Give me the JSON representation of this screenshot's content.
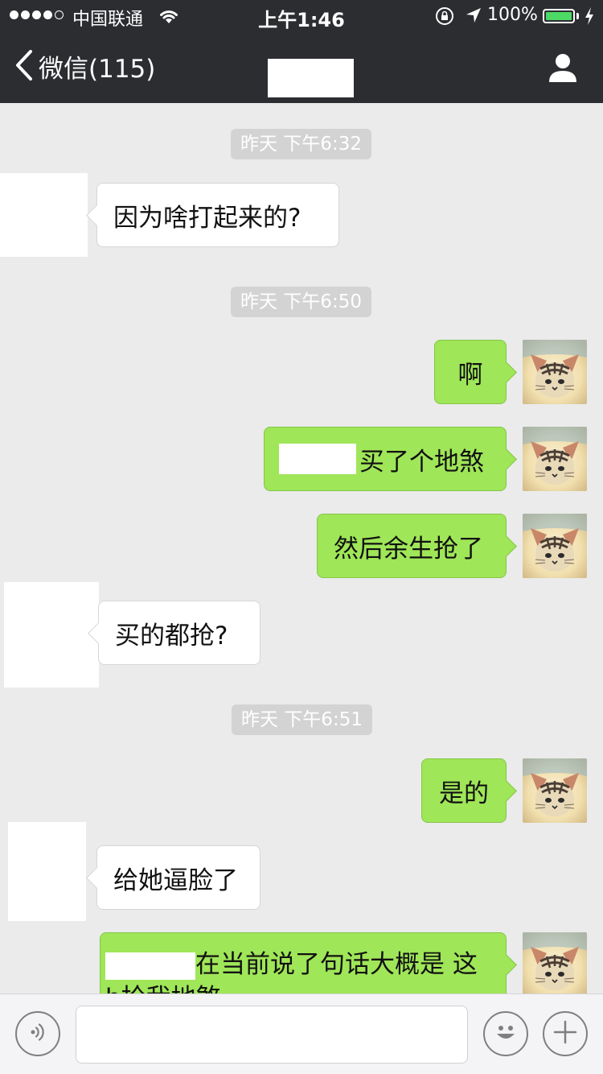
{
  "status_bar": {
    "carrier": "中国联通",
    "time": "上午1:46",
    "battery_percent": "100%",
    "signal_bars_filled": 4,
    "signal_bars_total": 5,
    "battery_level": 1.0,
    "battery_color": "#4cd964"
  },
  "nav": {
    "back_label": "微信(115)",
    "back_icon": "chevron-left-icon",
    "profile_icon": "person-icon"
  },
  "messages": [
    {
      "type": "timestamp",
      "text": "昨天 下午6:32"
    },
    {
      "type": "incoming",
      "text": "因为啥打起来的?"
    },
    {
      "type": "timestamp",
      "text": "昨天 下午6:50"
    },
    {
      "type": "outgoing",
      "text": "啊"
    },
    {
      "type": "outgoing",
      "text": "买了个地煞",
      "redacted_prefix": true
    },
    {
      "type": "outgoing",
      "text": "然后余生抢了"
    },
    {
      "type": "incoming",
      "text": "买的都抢?"
    },
    {
      "type": "timestamp",
      "text": "昨天 下午6:51"
    },
    {
      "type": "outgoing",
      "text": "是的"
    },
    {
      "type": "incoming",
      "text": "给她逼脸了"
    },
    {
      "type": "outgoing",
      "text": "在当前说了句话大概是 这b抢我地煞",
      "redacted_prefix": true
    }
  ],
  "input_bar": {
    "voice_icon": "voice-icon",
    "emoji_icon": "smiley-icon",
    "more_icon": "plus-icon"
  },
  "colors": {
    "nav_bg": "#2c2d31",
    "chat_bg": "#ebebeb",
    "outgoing_bubble": "#9fe658",
    "incoming_bubble": "#ffffff",
    "timestamp_bg": "#d3d3d3"
  }
}
